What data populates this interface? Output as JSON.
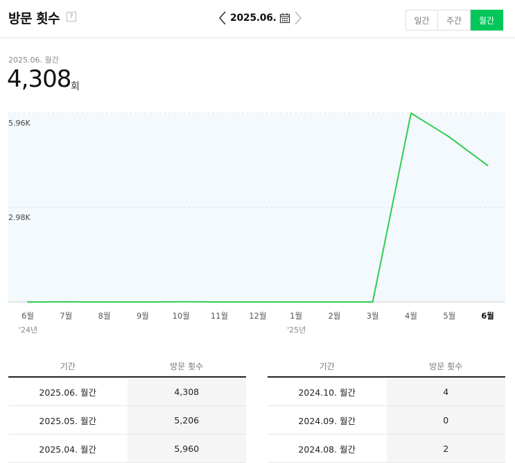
{
  "header": {
    "title": "방문 횟수",
    "help": "?",
    "current_date": "2025.06.",
    "periods": [
      {
        "label": "일간",
        "active": false
      },
      {
        "label": "주간",
        "active": false
      },
      {
        "label": "월간",
        "active": true
      }
    ]
  },
  "summary": {
    "label": "2025.06. 월간",
    "value": "4,308",
    "unit": "회"
  },
  "colors": {
    "accent": "#03c75a",
    "line": "#2fcd4f",
    "plot_bg": "#f4f9fd"
  },
  "chart_data": {
    "type": "line",
    "x": [
      "6월",
      "7월",
      "8월",
      "9월",
      "10월",
      "11월",
      "12월",
      "1월",
      "2월",
      "3월",
      "4월",
      "5월",
      "6월"
    ],
    "year_labels": [
      {
        "index": 0,
        "text": "'24년"
      },
      {
        "index": 7,
        "text": "'25년"
      }
    ],
    "series": [
      {
        "values": [
          0,
          2,
          0,
          0,
          4,
          0,
          0,
          0,
          0,
          0,
          5960,
          5206,
          4308
        ]
      }
    ],
    "y_ticks": [
      {
        "value": 2980,
        "label": "2.98K"
      },
      {
        "value": 5960,
        "label": "5.96K"
      }
    ],
    "ylim": [
      0,
      5960
    ],
    "highlight_index": 12,
    "grid": true
  },
  "table_headers": {
    "period": "기간",
    "visits": "방문 횟수"
  },
  "table_left": [
    {
      "period": "2025.06. 월간",
      "visits": "4,308"
    },
    {
      "period": "2025.05. 월간",
      "visits": "5,206"
    },
    {
      "period": "2025.04. 월간",
      "visits": "5,960"
    }
  ],
  "table_right": [
    {
      "period": "2024.10. 월간",
      "visits": "4"
    },
    {
      "period": "2024.09. 월간",
      "visits": "0"
    },
    {
      "period": "2024.08. 월간",
      "visits": "2"
    }
  ]
}
